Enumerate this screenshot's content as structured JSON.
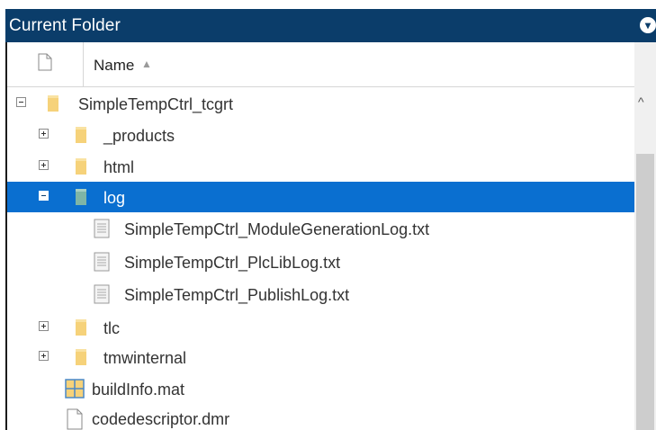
{
  "panel": {
    "title": "Current Folder",
    "menu_icon": "chevron-down-circle-icon"
  },
  "header": {
    "name_column": "Name",
    "sort_indicator": "▲"
  },
  "scrollbar": {
    "up_arrow": "^"
  },
  "tree": {
    "root": {
      "label": "SimpleTempCtrl_tcgrt",
      "expanded": true
    },
    "items": [
      {
        "label": "_products",
        "type": "folder",
        "expanded": false
      },
      {
        "label": "html",
        "type": "folder",
        "expanded": false
      },
      {
        "label": "log",
        "type": "folder",
        "expanded": true,
        "selected": true
      },
      {
        "label": "SimpleTempCtrl_ModuleGenerationLog.txt",
        "type": "text-file"
      },
      {
        "label": "SimpleTempCtrl_PlcLibLog.txt",
        "type": "text-file"
      },
      {
        "label": "SimpleTempCtrl_PublishLog.txt",
        "type": "text-file"
      },
      {
        "label": "tlc",
        "type": "folder",
        "expanded": false
      },
      {
        "label": "tmwinternal",
        "type": "folder",
        "expanded": false
      },
      {
        "label": "buildInfo.mat",
        "type": "mat-file"
      },
      {
        "label": "codedescriptor.dmr",
        "type": "file"
      }
    ]
  },
  "colors": {
    "title_bar": "#0b3d6a",
    "selection": "#0a6fd0",
    "folder": "#f6d27a"
  }
}
